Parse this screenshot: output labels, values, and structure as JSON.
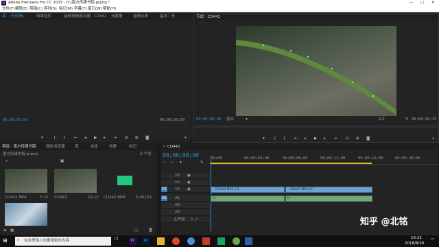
{
  "window": {
    "title": "Adobe Premiere Pro CC 2015 - D:\\南方传媒书院.prproj *",
    "controls": [
      "—",
      "□",
      "✕"
    ]
  },
  "menu": {
    "items": [
      "文件(F)",
      "编辑(E)",
      "剪辑(C)",
      "序列(S)",
      "标记(M)",
      "字幕(T)",
      "窗口(W)",
      "帮助(H)"
    ]
  },
  "source_panel": {
    "tabs": [
      "源：(无剪辑)",
      "效果控件",
      "音频剪辑混合器：CD442",
      "元数据",
      "音频仪表",
      "基本：无"
    ],
    "tc_left": "00;00;00;00",
    "tc_right": "00;00;00;00"
  },
  "program_panel": {
    "title": "节目：CD442",
    "tc_left": "00;00;00;00",
    "fit": "适合",
    "ratio": "1/2",
    "tc_right": "00;00;16;15"
  },
  "project_panel": {
    "tabs": [
      "项目：南方传媒书院",
      "媒体浏览器",
      "库",
      "信息",
      "效果",
      "标记"
    ],
    "file": "南方传媒书院.prproj",
    "count": "4 个项",
    "items": [
      {
        "name": "CD442.MP4",
        "dur": "7;15"
      },
      {
        "name": "CD442",
        "dur": "16;15"
      },
      {
        "name": "CD442.MP4",
        "dur": "5;00239"
      },
      {
        "name": "",
        "dur": ""
      }
    ]
  },
  "timeline": {
    "tab": "CD442",
    "tc": "00;00;00;00",
    "ruler": [
      "00;00",
      "00;00;04;00",
      "00;00;08;00",
      "00;00;12;00",
      "00;00;16;00",
      "00;00;20;00"
    ],
    "tracks": {
      "video": [
        "V3",
        "V2",
        "V1"
      ],
      "audio": [
        "A1",
        "A2",
        "A3"
      ],
      "master": "主声道",
      "master_val": "0.0"
    },
    "clips": {
      "v1a": "CD442.MP4 [V]",
      "v1b": "CD447.MP4 [V]",
      "a1a": "fx",
      "a1b": "fx"
    }
  },
  "taskbar": {
    "search": "在这里输入你要搜索的内容",
    "time": "16:22",
    "date": "2018/8/30",
    "watermark": "知乎 @北铭"
  },
  "colors": {
    "accent": "#2b8fd1",
    "video_clip": "#6fa3cf",
    "audio_clip": "#74a87a"
  }
}
